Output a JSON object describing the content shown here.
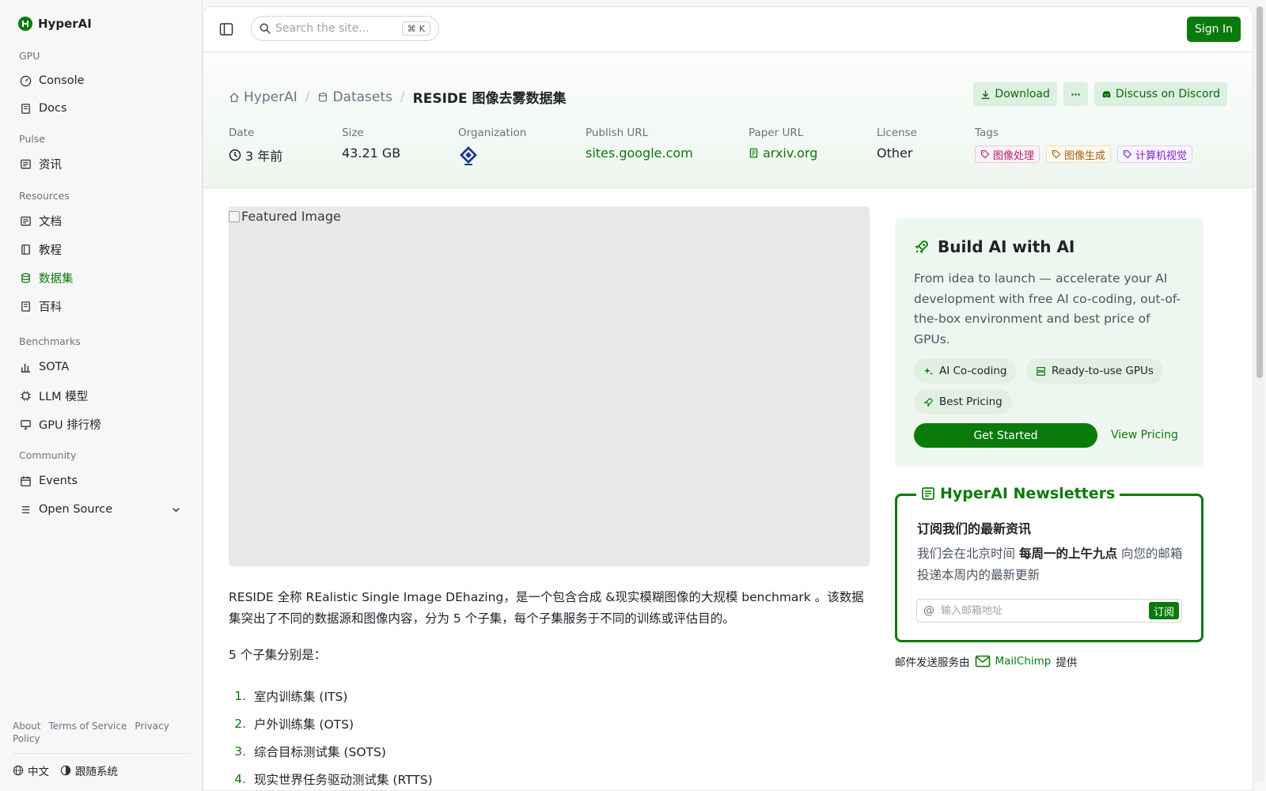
{
  "brand": {
    "name": "HyperAI"
  },
  "sidebar": {
    "sections": [
      {
        "label": "GPU",
        "items": [
          {
            "label": "Console",
            "icon": "gauge-icon"
          },
          {
            "label": "Docs",
            "icon": "book-icon"
          }
        ]
      },
      {
        "label": "Pulse",
        "items": [
          {
            "label": "资讯",
            "icon": "newspaper-icon"
          }
        ]
      },
      {
        "label": "Resources",
        "items": [
          {
            "label": "文档",
            "icon": "newspaper-icon"
          },
          {
            "label": "教程",
            "icon": "book-open-icon"
          },
          {
            "label": "数据集",
            "icon": "database-icon",
            "active": true
          },
          {
            "label": "百科",
            "icon": "book-icon"
          }
        ]
      },
      {
        "label": "Benchmarks",
        "items": [
          {
            "label": "SOTA",
            "icon": "bar-chart-icon"
          },
          {
            "label": "LLM 模型",
            "icon": "chip-icon"
          },
          {
            "label": "GPU 排行榜",
            "icon": "monitor-icon"
          }
        ]
      },
      {
        "label": "Community",
        "items": [
          {
            "label": "Events",
            "icon": "calendar-icon"
          },
          {
            "label": "Open Source",
            "icon": "list-icon"
          }
        ]
      }
    ],
    "footer_links": [
      "About",
      "Terms of Service",
      "Privacy Policy"
    ],
    "language": "中文",
    "theme": "跟随系统"
  },
  "topbar": {
    "search_placeholder": "Search the site...",
    "shortcut": "K",
    "signin_label": "Sign In"
  },
  "breadcrumb": {
    "home": "HyperAI",
    "section": "Datasets",
    "current": "RESIDE 图像去雾数据集"
  },
  "header_buttons": {
    "download": "Download",
    "discord": "Discuss on Discord"
  },
  "meta": {
    "date_label": "Date",
    "date_value": "3 年前",
    "size_label": "Size",
    "size_value": "43.21 GB",
    "org_label": "Organization",
    "publish_label": "Publish URL",
    "publish_value": "sites.google.com",
    "paper_label": "Paper URL",
    "paper_value": "arxiv.org",
    "license_label": "License",
    "license_value": "Other",
    "tags_label": "Tags",
    "tags": [
      {
        "label": "图像处理",
        "color": "#b4236b"
      },
      {
        "label": "图像生成",
        "color": "#a16207"
      },
      {
        "label": "计算机视觉",
        "color": "#7e22ce"
      }
    ]
  },
  "content": {
    "featured_alt": "Featured Image",
    "description": "RESIDE 全称 REalistic Single Image DEhazing，是一个包含合成 &现实模糊图像的大规模 benchmark 。该数据集突出了不同的数据源和图像内容，分为 5 个子集，每个子集服务于不同的训练或评估目的。",
    "subsets_intro": "5 个子集分别是：",
    "subsets": [
      "室内训练集 (ITS)",
      "户外训练集 (OTS)",
      "综合目标测试集 (SOTS)",
      "现实世界任务驱动测试集 (RTTS)"
    ]
  },
  "promo": {
    "title": "Build AI with AI",
    "body": "From idea to launch — accelerate your AI development with free AI co-coding, out-of-the-box environment and best price of GPUs.",
    "chips": [
      "AI Co-coding",
      "Ready-to-use GPUs",
      "Best Pricing"
    ],
    "cta": "Get Started",
    "secondary": "View Pricing"
  },
  "newsletter": {
    "title": "HyperAI Newsletters",
    "heading": "订阅我们的最新资讯",
    "text_before": "我们会在北京时间 ",
    "text_bold": "每周一的上午九点",
    "text_after": " 向您的邮箱投递本周内的最新更新",
    "email_placeholder": "输入邮箱地址",
    "subscribe_label": "订阅",
    "provider_before": "邮件发送服务由",
    "provider": "MailChimp",
    "provider_after": "提供"
  },
  "colors": {
    "accent": "#0a7a0a",
    "accent_light": "#eef7ef"
  }
}
